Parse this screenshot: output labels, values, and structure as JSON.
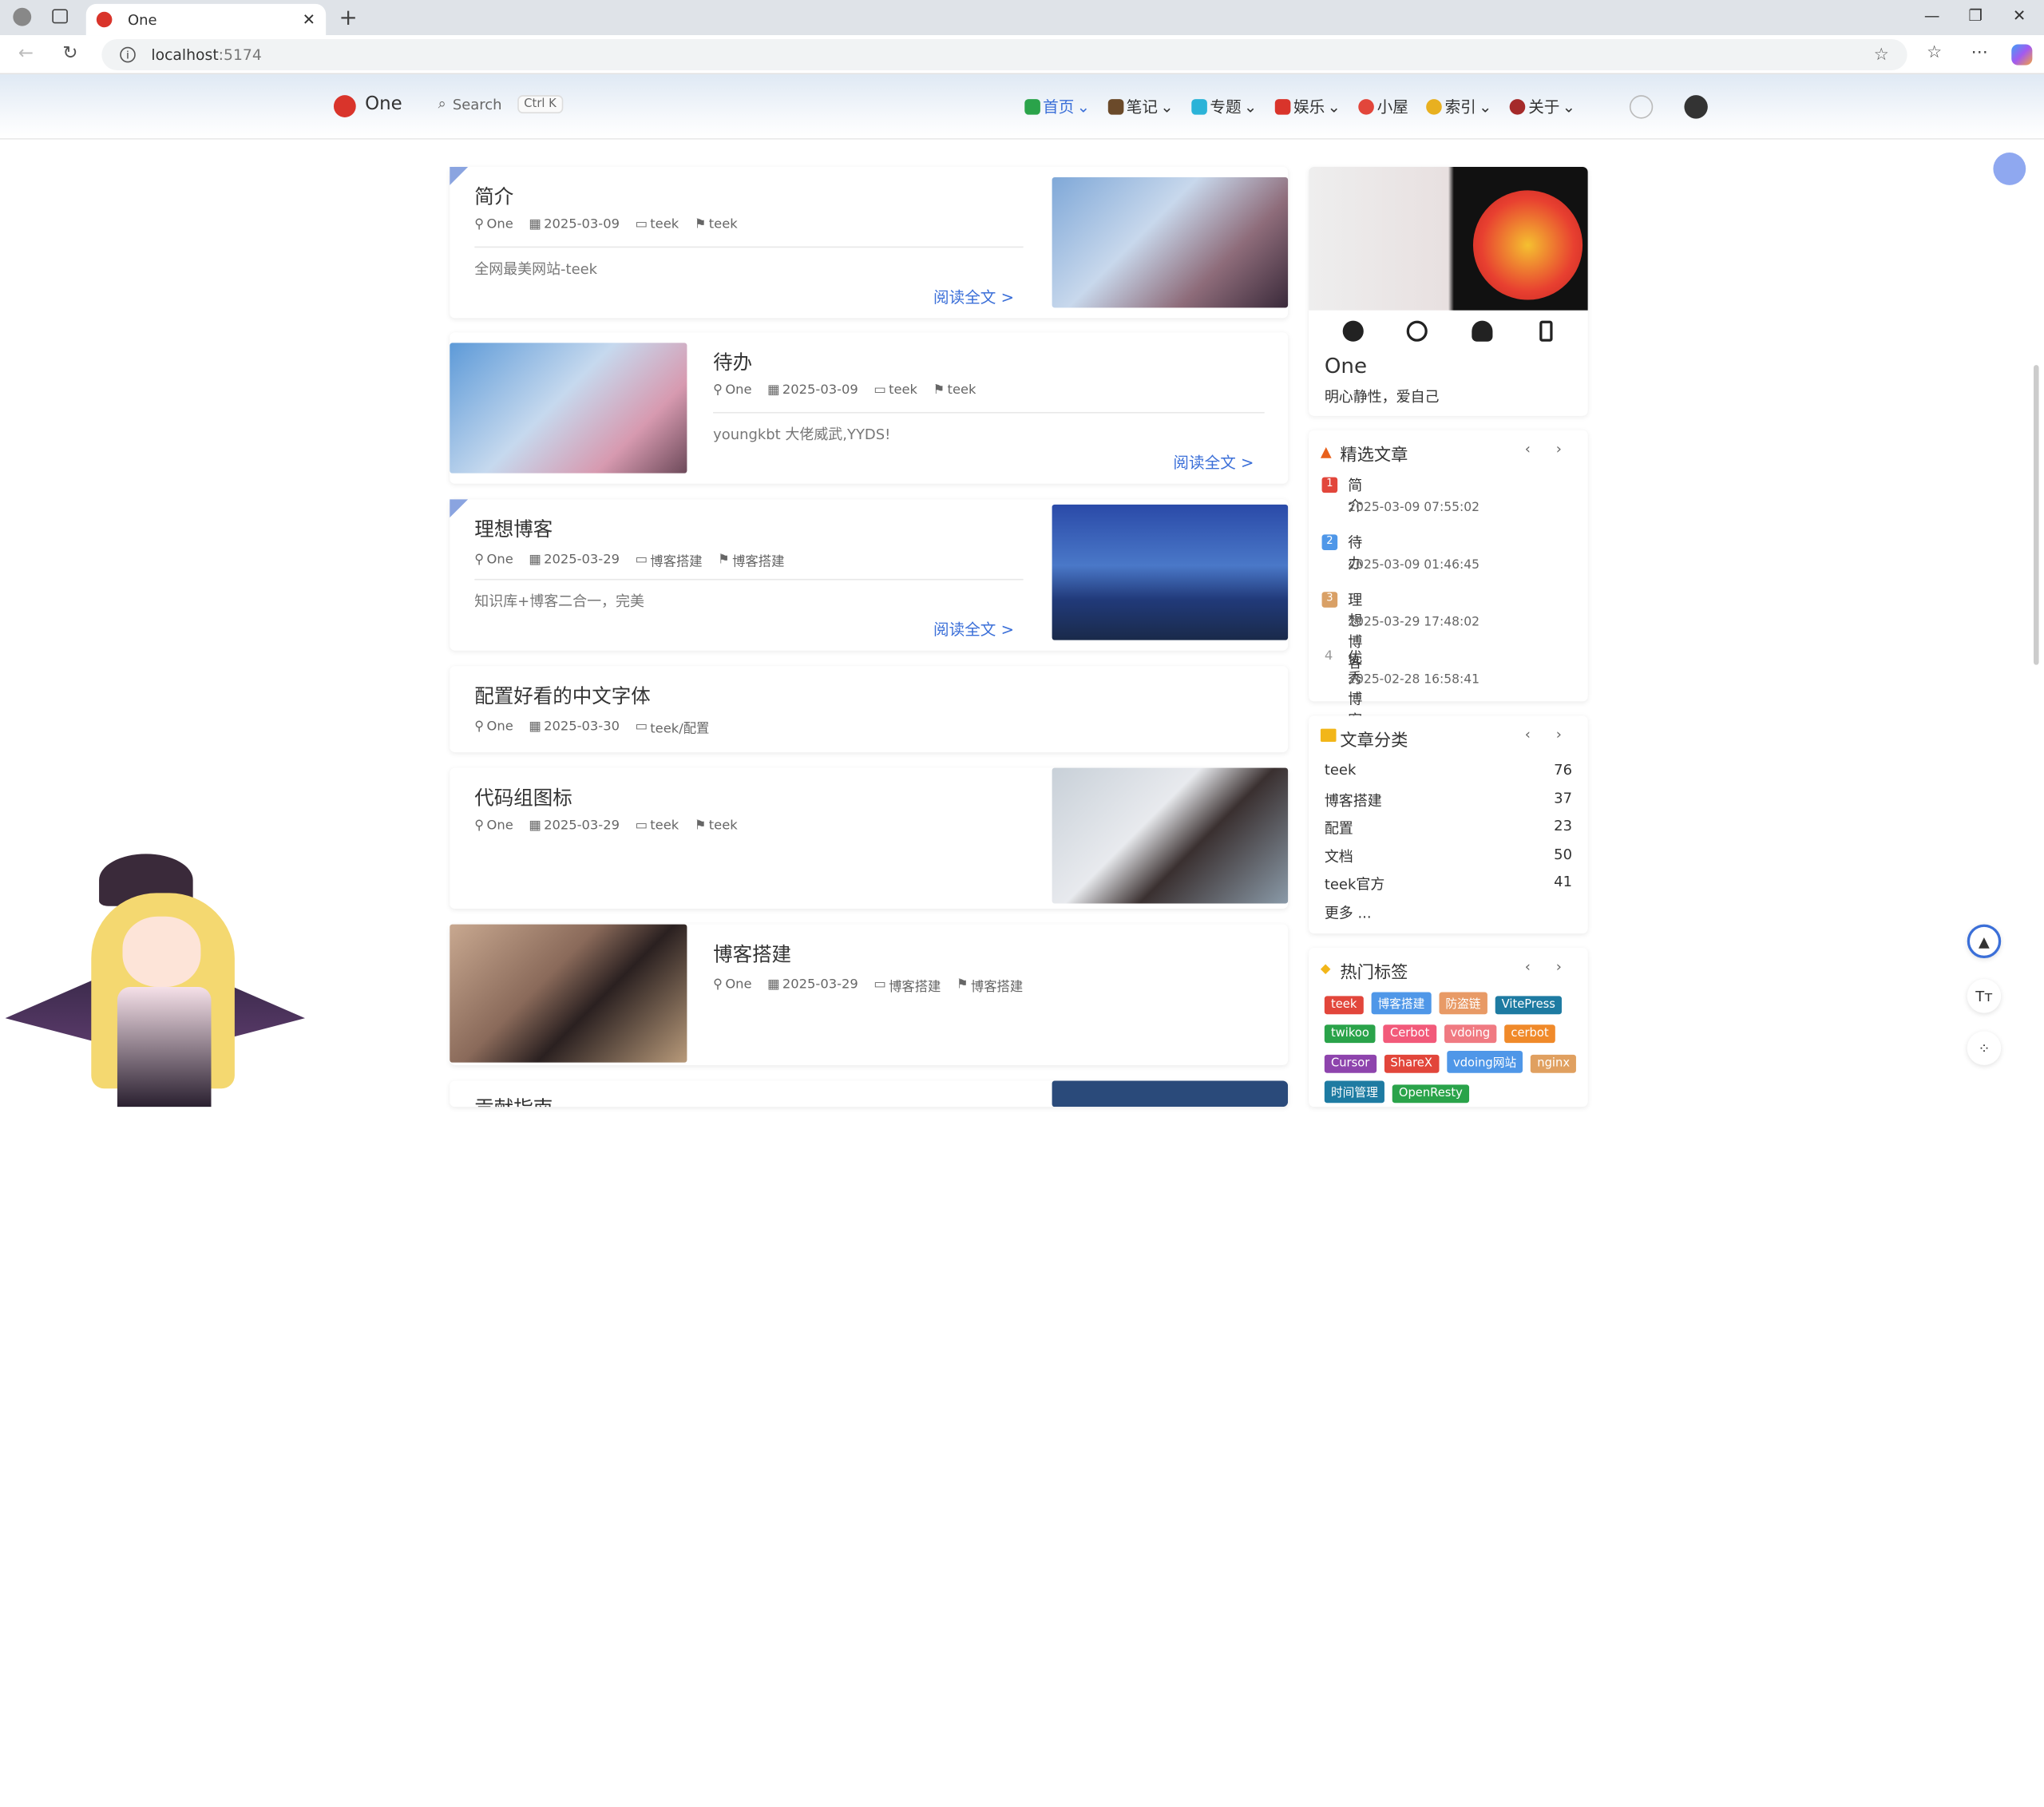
{
  "browser": {
    "tab_title": "One",
    "url_host": "localhost",
    "url_port": ":5174"
  },
  "nav": {
    "site": "One",
    "search": "Search",
    "kbd": "Ctrl K",
    "menu": [
      "首页",
      "笔记",
      "专题",
      "娱乐",
      "小屋",
      "索引",
      "关于"
    ]
  },
  "posts": [
    {
      "title": "简介",
      "author": "One",
      "date": "2025-03-09",
      "cat": "teek",
      "tag": "teek",
      "excerpt": "全网最美网站-teek",
      "more": "阅读全文 >"
    },
    {
      "title": "待办",
      "author": "One",
      "date": "2025-03-09",
      "cat": "teek",
      "tag": "teek",
      "excerpt": "youngkbt 大佬威武,YYDS!",
      "more": "阅读全文 >"
    },
    {
      "title": "理想博客",
      "author": "One",
      "date": "2025-03-29",
      "cat": "博客搭建",
      "tag": "博客搭建",
      "excerpt": "知识库+博客二合一，完美",
      "more": "阅读全文 >"
    },
    {
      "title": "配置好看的中文字体",
      "author": "One",
      "date": "2025-03-30",
      "cat": "teek/配置"
    },
    {
      "title": "代码组图标",
      "author": "One",
      "date": "2025-03-29",
      "cat": "teek",
      "tag": "teek"
    },
    {
      "title": "博客搭建",
      "author": "One",
      "date": "2025-03-29",
      "cat": "博客搭建",
      "tag": "博客搭建"
    },
    {
      "title": "贡献指南"
    }
  ],
  "profile": {
    "name": "One",
    "motto": "明心静性，爱自己"
  },
  "featured": {
    "title": "精选文章",
    "items": [
      {
        "n": "1",
        "t": "简介",
        "d": "2025-03-09 07:55:02"
      },
      {
        "n": "2",
        "t": "待办",
        "d": "2025-03-09 01:46:45"
      },
      {
        "n": "3",
        "t": "理想博客",
        "d": "2025-03-29 17:48:02"
      },
      {
        "n": "4",
        "t": "优秀博客",
        "d": "2025-02-28 16:58:41"
      }
    ]
  },
  "categories": {
    "title": "文章分类",
    "items": [
      {
        "k": "teek",
        "v": "76"
      },
      {
        "k": "博客搭建",
        "v": "37"
      },
      {
        "k": "配置",
        "v": "23"
      },
      {
        "k": "文档",
        "v": "50"
      },
      {
        "k": "teek官方",
        "v": "41"
      }
    ],
    "more": "更多 ..."
  },
  "tags": {
    "title": "热门标签",
    "items": [
      {
        "t": "teek",
        "c": "#e2463b"
      },
      {
        "t": "博客搭建",
        "c": "#4f97e8"
      },
      {
        "t": "防盗链",
        "c": "#e89a66"
      },
      {
        "t": "VitePress",
        "c": "#1e7ba2"
      },
      {
        "t": "twikoo",
        "c": "#2aa34a"
      },
      {
        "t": "Cerbot",
        "c": "#f25a7a"
      },
      {
        "t": "vdoing",
        "c": "#f07a82"
      },
      {
        "t": "cerbot",
        "c": "#f08a2a"
      },
      {
        "t": "Cursor",
        "c": "#8e44ad"
      },
      {
        "t": "ShareX",
        "c": "#e2463b"
      },
      {
        "t": "vdoing网站",
        "c": "#4f97e8"
      },
      {
        "t": "nginx",
        "c": "#e0a060"
      },
      {
        "t": "时间管理",
        "c": "#1e7ba2"
      },
      {
        "t": "OpenResty",
        "c": "#2aa34a"
      }
    ]
  },
  "float": {
    "font": "Tт"
  }
}
